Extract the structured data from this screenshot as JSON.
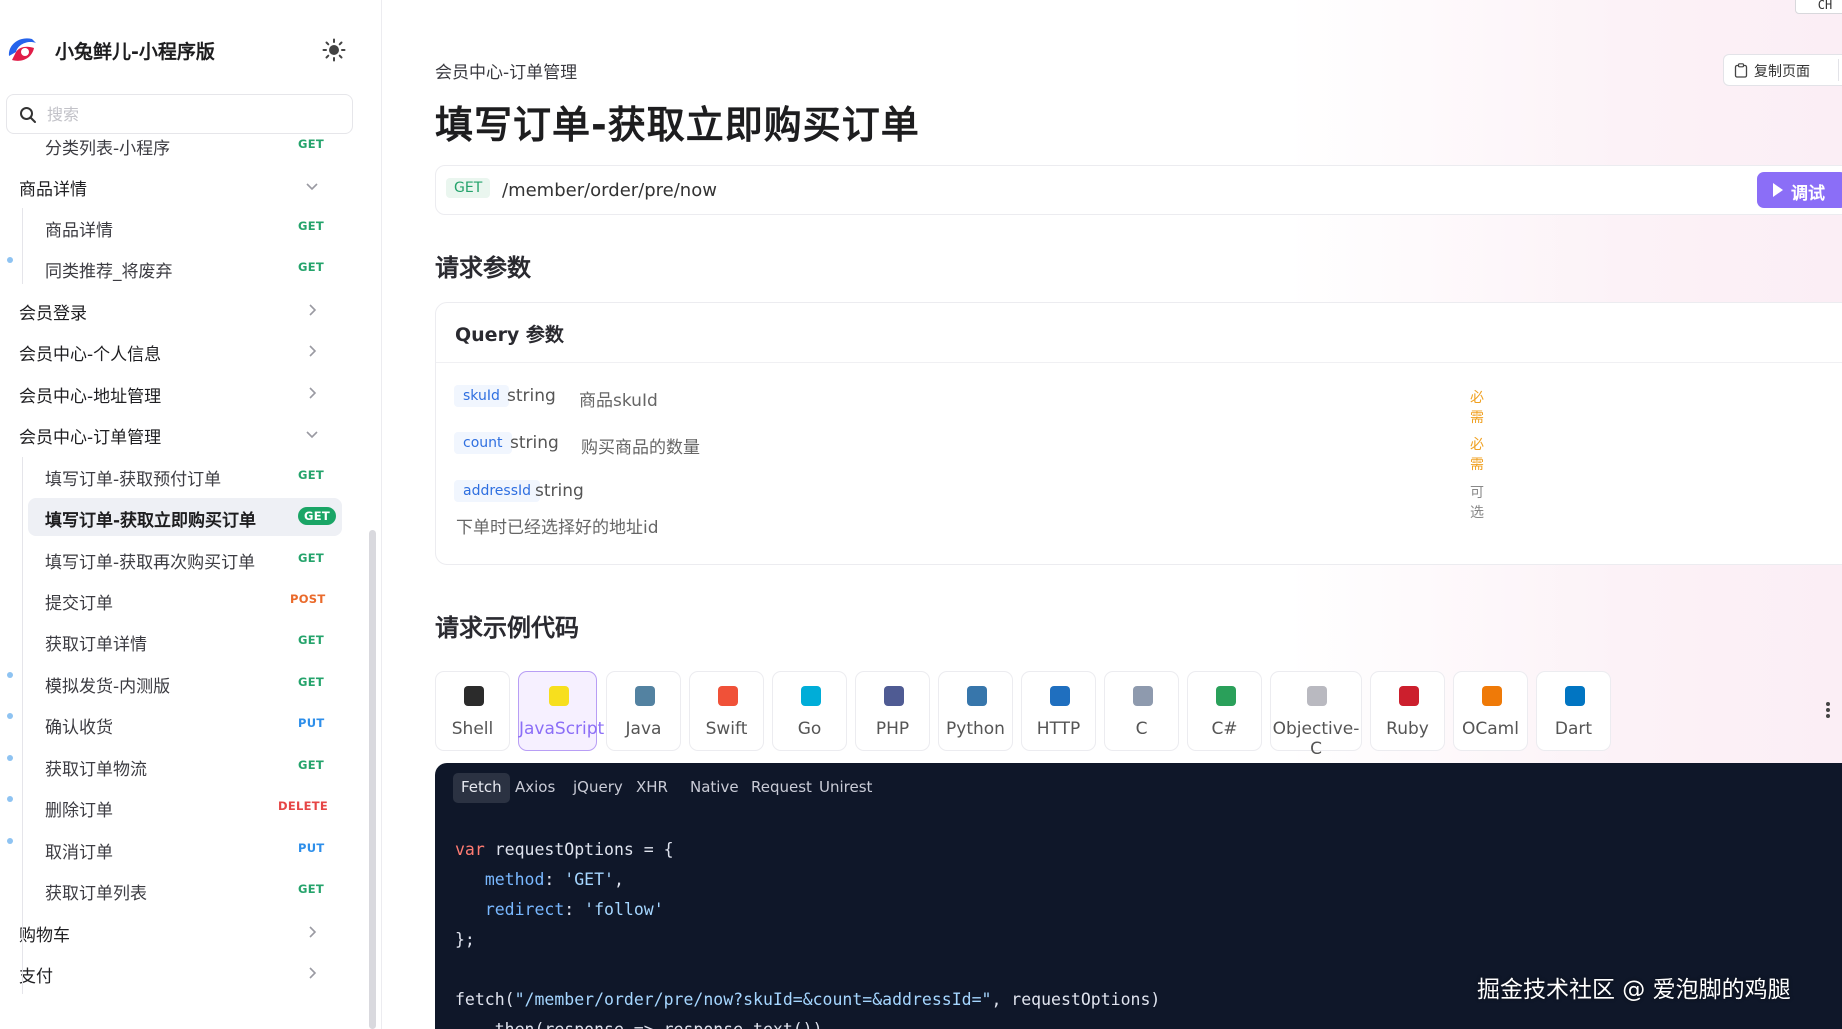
{
  "app": {
    "name": "小兔鲜儿-小程序版",
    "search_placeholder": "搜索"
  },
  "sidebar": {
    "groups": [
      {
        "label": "分类列表-小程序",
        "kind": "item",
        "method": "GET"
      },
      {
        "label": "商品详情",
        "kind": "group",
        "expanded": true
      },
      {
        "label": "商品详情",
        "kind": "item",
        "method": "GET"
      },
      {
        "label": "同类推荐_将废弃",
        "kind": "item",
        "method": "GET",
        "dot": true
      },
      {
        "label": "会员登录",
        "kind": "group",
        "expanded": false
      },
      {
        "label": "会员中心-个人信息",
        "kind": "group",
        "expanded": false
      },
      {
        "label": "会员中心-地址管理",
        "kind": "group",
        "expanded": false
      },
      {
        "label": "会员中心-订单管理",
        "kind": "group",
        "expanded": true
      },
      {
        "label": "填写订单-获取预付订单",
        "kind": "item",
        "method": "GET"
      },
      {
        "label": "填写订单-获取立即购买订单",
        "kind": "item",
        "method": "GET",
        "active": true
      },
      {
        "label": "填写订单-获取再次购买订单",
        "kind": "item",
        "method": "GET"
      },
      {
        "label": "提交订单",
        "kind": "item",
        "method": "POST"
      },
      {
        "label": "获取订单详情",
        "kind": "item",
        "method": "GET"
      },
      {
        "label": "模拟发货-内测版",
        "kind": "item",
        "method": "GET",
        "dot": true
      },
      {
        "label": "确认收货",
        "kind": "item",
        "method": "PUT",
        "dot": true
      },
      {
        "label": "获取订单物流",
        "kind": "item",
        "method": "GET",
        "dot": true
      },
      {
        "label": "删除订单",
        "kind": "item",
        "method": "DELETE",
        "dot": true
      },
      {
        "label": "取消订单",
        "kind": "item",
        "method": "PUT",
        "dot": true
      },
      {
        "label": "获取订单列表",
        "kind": "item",
        "method": "GET"
      },
      {
        "label": "购物车",
        "kind": "group",
        "expanded": false
      },
      {
        "label": "支付",
        "kind": "group",
        "expanded": false
      }
    ]
  },
  "header": {
    "breadcrumb": "会员中心-订单管理",
    "title": "填写订单-获取立即购买订单",
    "copy_label": "复制页面",
    "corner_text": "CH"
  },
  "endpoint": {
    "method": "GET",
    "path": "/member/order/pre/now",
    "try_label": "调试"
  },
  "params": {
    "section_title": "请求参数",
    "card_title": "Query 参数",
    "rows": [
      {
        "name": "skuId",
        "type": "string",
        "desc": "商品skuId",
        "required": "必需"
      },
      {
        "name": "count",
        "type": "string",
        "desc": "购买商品的数量",
        "required": "必需"
      },
      {
        "name": "addressId",
        "type": "string",
        "desc": "",
        "required": "可选"
      }
    ],
    "extra_desc": "下单时已经选择好的地址id"
  },
  "code_examples": {
    "section_title": "请求示例代码",
    "languages": [
      {
        "label": "Shell",
        "color": "#2b2b2b"
      },
      {
        "label": "JavaScript",
        "color": "#f7df1e",
        "active": true
      },
      {
        "label": "Java",
        "color": "#5382a1"
      },
      {
        "label": "Swift",
        "color": "#f05138"
      },
      {
        "label": "Go",
        "color": "#00add8"
      },
      {
        "label": "PHP",
        "color": "#4f5b93"
      },
      {
        "label": "Python",
        "color": "#3776ab"
      },
      {
        "label": "HTTP",
        "color": "#1f6fbf"
      },
      {
        "label": "C",
        "color": "#8e9aae"
      },
      {
        "label": "C#",
        "color": "#2aa05a"
      },
      {
        "label": "Objective-C",
        "color": "#b9b9c0"
      },
      {
        "label": "Ruby",
        "color": "#cc1f2d"
      },
      {
        "label": "OCaml",
        "color": "#ef7a08"
      },
      {
        "label": "Dart",
        "color": "#0175c2"
      }
    ],
    "libraries": [
      "Fetch",
      "Axios",
      "jQuery",
      "XHR",
      "Native",
      "Request",
      "Unirest"
    ],
    "active_library": "Fetch",
    "code_lines": [
      "var requestOptions = {",
      "   method: 'GET',",
      "   redirect: 'follow'",
      "};",
      "",
      "fetch(\"/member/order/pre/now?skuId=&count=&addressId=\", requestOptions)",
      "   .then(response => response.text())"
    ]
  },
  "watermark": "掘金技术社区 @ 爱泡脚的鸡腿"
}
